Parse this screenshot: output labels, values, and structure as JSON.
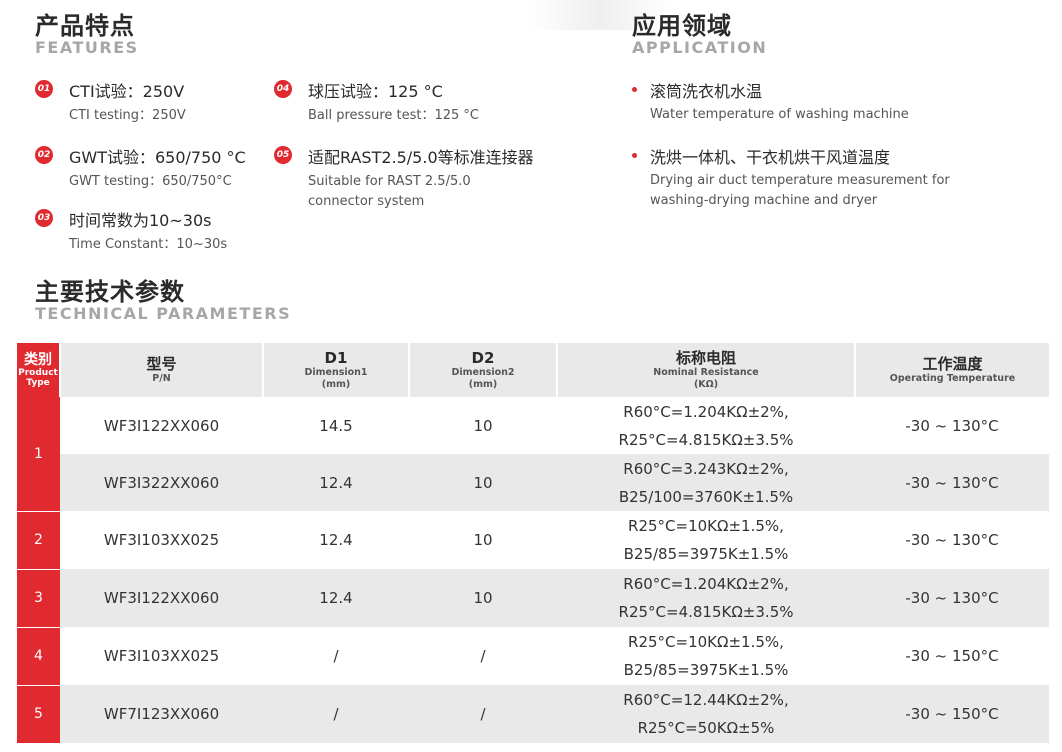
{
  "features": {
    "title_cn": "产品特点",
    "title_en": "FEATURES",
    "items": [
      {
        "num": "01",
        "cn": "CTI试验：250V",
        "en": "CTI testing：250V"
      },
      {
        "num": "02",
        "cn": "GWT试验：650/750 °C",
        "en": "GWT testing：650/750°C"
      },
      {
        "num": "03",
        "cn": "时间常数为10~30s",
        "en": "Time Constant：10~30s"
      },
      {
        "num": "04",
        "cn": "球压试验：125 °C",
        "en": "Ball pressure test：125 °C"
      },
      {
        "num": "05",
        "cn": "适配RAST2.5/5.0等标准连接器",
        "en_line1": "Suitable for RAST 2.5/5.0",
        "en_line2": "connector system"
      }
    ]
  },
  "application": {
    "title_cn": "应用领域",
    "title_en": "APPLICATION",
    "items": [
      {
        "cn": "滚筒洗衣机水温",
        "en": "Water temperature of washing machine"
      },
      {
        "cn": "洗烘一体机、干衣机烘干风道温度",
        "en_line1": "Drying air duct temperature measurement for",
        "en_line2": "washing-drying machine and dryer"
      }
    ]
  },
  "params": {
    "title_cn": "主要技术参数",
    "title_en": "TECHNICAL PARAMETERS",
    "headers": {
      "type_cn": "类别",
      "type_en1": "Product",
      "type_en2": "Type",
      "pn_cn": "型号",
      "pn_en": "P/N",
      "d1_cn": "D1",
      "d1_en": "Dimension1",
      "d1_unit": "(mm)",
      "d2_cn": "D2",
      "d2_en": "Dimension2",
      "d2_unit": "(mm)",
      "res_cn": "标称电阻",
      "res_en": "Nominal Resistance",
      "res_unit": "(KΩ)",
      "temp_cn": "工作温度",
      "temp_en": "Operating Temperature"
    },
    "rows": [
      {
        "type": "1",
        "pn": "WF3I122XX060",
        "d1": "14.5",
        "d2": "10",
        "res1": "R60°C=1.204KΩ±2%,",
        "res2": "R25°C=4.815KΩ±3.5%",
        "temp": "-30 ~ 130°C"
      },
      {
        "type": "",
        "pn": "WF3I322XX060",
        "d1": "12.4",
        "d2": "10",
        "res1": "R60°C=3.243KΩ±2%,",
        "res2": "B25/100=3760K±1.5%",
        "temp": "-30 ~ 130°C"
      },
      {
        "type": "2",
        "pn": "WF3I103XX025",
        "d1": "12.4",
        "d2": "10",
        "res1": "R25°C=10KΩ±1.5%,",
        "res2": "B25/85=3975K±1.5%",
        "temp": "-30 ~ 130°C"
      },
      {
        "type": "3",
        "pn": "WF3I122XX060",
        "d1": "12.4",
        "d2": "10",
        "res1": "R60°C=1.204KΩ±2%,",
        "res2": "R25°C=4.815KΩ±3.5%",
        "temp": "-30 ~ 130°C"
      },
      {
        "type": "4",
        "pn": "WF3I103XX025",
        "d1": "/",
        "d2": "/",
        "res1": "R25°C=10KΩ±1.5%,",
        "res2": "B25/85=3975K±1.5%",
        "temp": "-30 ~ 150°C"
      },
      {
        "type": "5",
        "pn": "WF7I123XX060",
        "d1": "/",
        "d2": "/",
        "res1": "R60°C=12.44KΩ±2%,",
        "res2": "R25°C=50KΩ±5%",
        "temp": "-30 ~ 150°C"
      }
    ]
  },
  "colors": {
    "accent": "#e02a2f",
    "row_shade": "#e9e9e9",
    "subtitle_grey": "#a7a7a7"
  }
}
